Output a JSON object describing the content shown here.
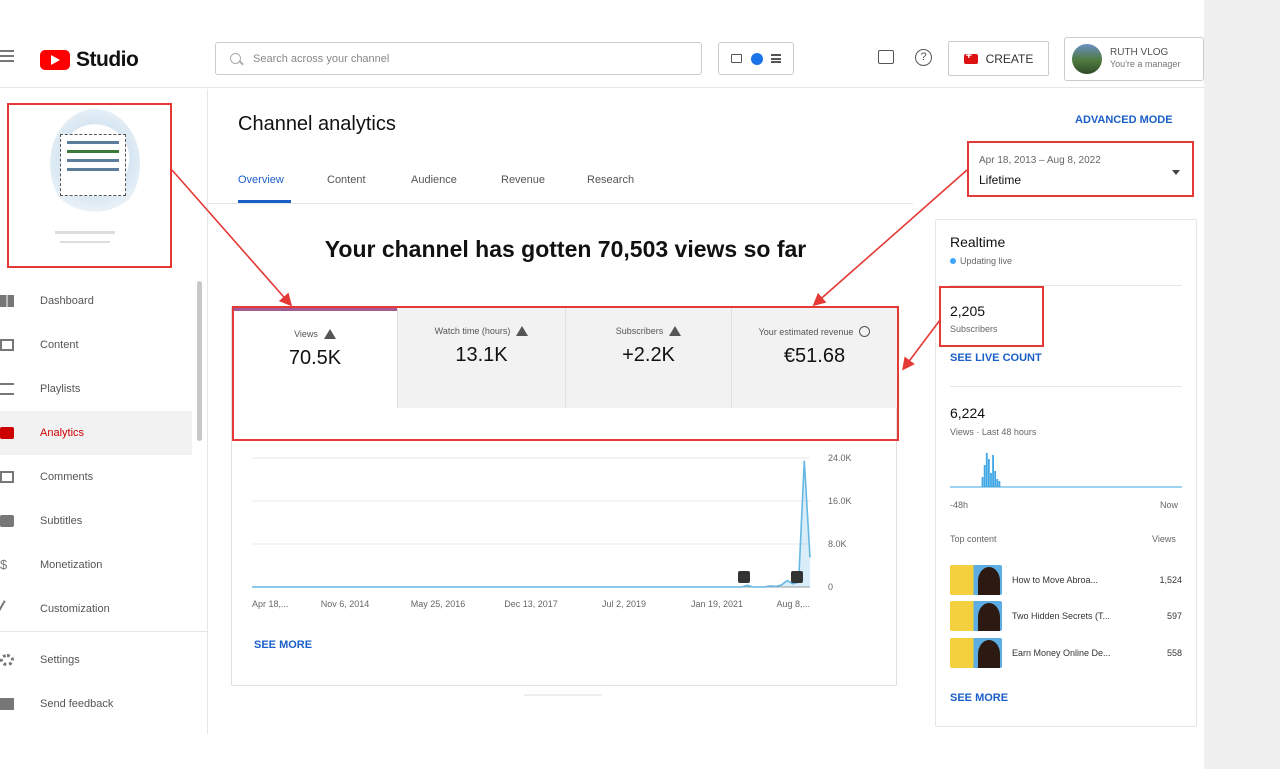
{
  "header": {
    "logo_text": "Studio",
    "search_placeholder": "Search across your channel",
    "create_label": "CREATE",
    "account_name": "RUTH VLOG",
    "account_role": "You're a manager"
  },
  "sidebar": {
    "items": [
      {
        "label": "Dashboard",
        "icon": "dashboard-icon"
      },
      {
        "label": "Content",
        "icon": "content-icon"
      },
      {
        "label": "Playlists",
        "icon": "playlists-icon"
      },
      {
        "label": "Analytics",
        "icon": "analytics-icon",
        "active": true
      },
      {
        "label": "Comments",
        "icon": "comments-icon"
      },
      {
        "label": "Subtitles",
        "icon": "subtitles-icon"
      },
      {
        "label": "Monetization",
        "icon": "dollar-icon"
      },
      {
        "label": "Customization",
        "icon": "wand-icon"
      }
    ],
    "bottom_items": [
      {
        "label": "Settings",
        "icon": "gear-icon"
      },
      {
        "label": "Send feedback",
        "icon": "feedback-icon"
      }
    ]
  },
  "main": {
    "title": "Channel analytics",
    "advanced_mode": "ADVANCED MODE",
    "tabs": [
      {
        "label": "Overview",
        "active": true
      },
      {
        "label": "Content"
      },
      {
        "label": "Audience"
      },
      {
        "label": "Revenue"
      },
      {
        "label": "Research"
      }
    ],
    "date_range": "Apr 18, 2013 – Aug 8, 2022",
    "date_label": "Lifetime",
    "headline": "Your channel has gotten 70,503 views so far",
    "metrics": [
      {
        "label": "Views",
        "value": "70.5K",
        "icon": "warning-icon"
      },
      {
        "label": "Watch time (hours)",
        "value": "13.1K",
        "icon": "warning-icon"
      },
      {
        "label": "Subscribers",
        "value": "+2.2K",
        "icon": "warning-icon"
      },
      {
        "label": "Your estimated revenue",
        "value": "€51.68",
        "icon": "clock-icon"
      }
    ],
    "see_more": "SEE MORE"
  },
  "chart_data": {
    "type": "line",
    "x_tick_labels": [
      "Apr 18,...",
      "Nov 6, 2014",
      "May 25, 2016",
      "Dec 13, 2017",
      "Jul 2, 2019",
      "Jan 19, 2021",
      "Aug 8,..."
    ],
    "y_tick_labels": [
      "24.0K",
      "16.0K",
      "8.0K",
      "0"
    ],
    "ylim": [
      0,
      24000
    ],
    "series": [
      {
        "values": [
          0,
          0,
          0,
          0,
          0,
          0,
          0,
          0,
          0,
          0,
          0,
          0,
          0,
          0,
          0,
          0,
          0,
          0,
          0,
          0,
          0,
          0,
          0,
          0,
          0,
          0,
          0,
          0,
          0,
          0,
          0,
          0,
          0,
          0,
          0,
          0,
          0,
          0,
          0,
          0,
          0,
          0,
          0,
          0,
          0,
          0,
          0,
          0,
          0,
          0,
          0,
          0,
          0,
          0,
          0,
          0,
          0,
          0,
          0,
          0,
          0,
          0,
          0,
          0,
          0,
          0,
          0,
          0,
          0,
          0,
          0,
          0,
          0,
          0,
          0,
          0,
          0,
          0,
          0,
          0,
          0,
          0,
          0,
          0,
          0,
          0,
          0,
          300,
          0,
          0,
          0,
          200,
          100,
          400,
          1200,
          600,
          900,
          23500,
          5500
        ]
      }
    ],
    "color": "#65b8e4",
    "grid": true
  },
  "realtime": {
    "title": "Realtime",
    "status": "Updating live",
    "subscribers_value": "2,205",
    "subscribers_label": "Subscribers",
    "see_live": "SEE LIVE COUNT",
    "views_value": "6,224",
    "views_label": "Views · Last 48 hours",
    "axis_left": "-48h",
    "axis_right": "Now",
    "bar_values": [
      0,
      0,
      0,
      0,
      0,
      0,
      0,
      0,
      0,
      0,
      0,
      0,
      0,
      0,
      0,
      0,
      0,
      0,
      0,
      0,
      0,
      0,
      0,
      0,
      0,
      0,
      0,
      0,
      0,
      0,
      0,
      0,
      0,
      0,
      0,
      0,
      0,
      0,
      0,
      0,
      0,
      0,
      0,
      0,
      0,
      0,
      0,
      0,
      0,
      0,
      0,
      0,
      0,
      0,
      0,
      0,
      0,
      0,
      0,
      0,
      0,
      0,
      0,
      0,
      0,
      0,
      0,
      0,
      0,
      0,
      0,
      0,
      0,
      0,
      0,
      0,
      0,
      0,
      0,
      0,
      0,
      0,
      0,
      0,
      0,
      0,
      0,
      0,
      0,
      0,
      0,
      0,
      0,
      0,
      0,
      0,
      0,
      0,
      0,
      0,
      0,
      0,
      0,
      0,
      0,
      0,
      0,
      0,
      0,
      0
    ],
    "bar_spikes": [
      {
        "index": 5,
        "value": 0.25
      },
      {
        "index": 6,
        "value": 0.55
      },
      {
        "index": 7,
        "value": 0.85
      },
      {
        "index": 8,
        "value": 0.7
      },
      {
        "index": 9,
        "value": 0.35
      },
      {
        "index": 10,
        "value": 0.8
      },
      {
        "index": 11,
        "value": 0.4
      },
      {
        "index": 12,
        "value": 0.2
      },
      {
        "index": 13,
        "value": 0.15
      }
    ],
    "top_content_label": "Top content",
    "top_views_label": "Views",
    "top_content": [
      {
        "title": "How to Move Abroa...",
        "views": "1,524"
      },
      {
        "title": "Two Hidden Secrets (T...",
        "views": "597"
      },
      {
        "title": "Earn Money Online De...",
        "views": "558"
      }
    ],
    "see_more": "SEE MORE"
  },
  "colors": {
    "accent_blue": "#1a5fc7",
    "annotation_red": "#e53935",
    "brand_red": "#ff0000",
    "chart_blue": "#65b8e4"
  }
}
